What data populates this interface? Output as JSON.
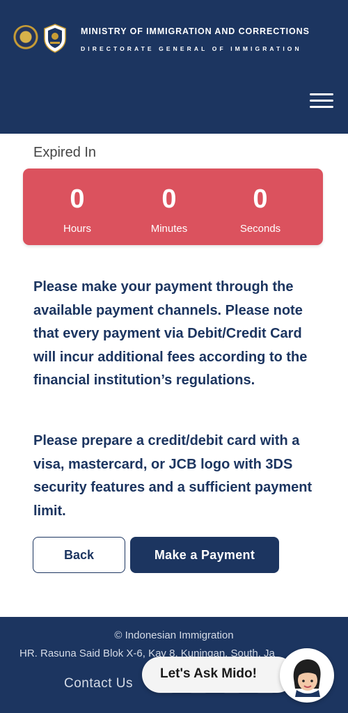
{
  "header": {
    "title": "MINISTRY OF IMMIGRATION AND CORRECTIONS",
    "subtitle": "DIRECTORATE GENERAL OF IMMIGRATION",
    "menu_icon": "hamburger-menu-icon"
  },
  "countdown": {
    "label": "Expired In",
    "hours": "0",
    "hours_label": "Hours",
    "minutes": "0",
    "minutes_label": "Minutes",
    "seconds": "0",
    "seconds_label": "Seconds",
    "color": "#db525e"
  },
  "instructions": {
    "paragraph1": "Please make your payment through the available payment channels. Please note that every payment via Debit/Credit Card will incur additional fees according to the financial institution’s regulations.",
    "paragraph2": "Please prepare a credit/debit card with a visa, mastercard, or JCB logo with 3DS security features and a sufficient payment limit."
  },
  "actions": {
    "back_label": "Back",
    "pay_label": "Make a Payment"
  },
  "footer": {
    "copyright": "© Indonesian Immigration",
    "address": "HR. Rasuna Said Blok X-6, Kav 8, Kuningan, South, Ja",
    "contact_label": "Contact Us",
    "social_icons": [
      "facebook-icon",
      "instagram-icon",
      "twitter-icon",
      "youtube-icon"
    ]
  },
  "chat": {
    "label": "Let's Ask Mido!"
  },
  "colors": {
    "primary": "#1c3560",
    "timer_bg": "#db525e",
    "white": "#ffffff"
  }
}
